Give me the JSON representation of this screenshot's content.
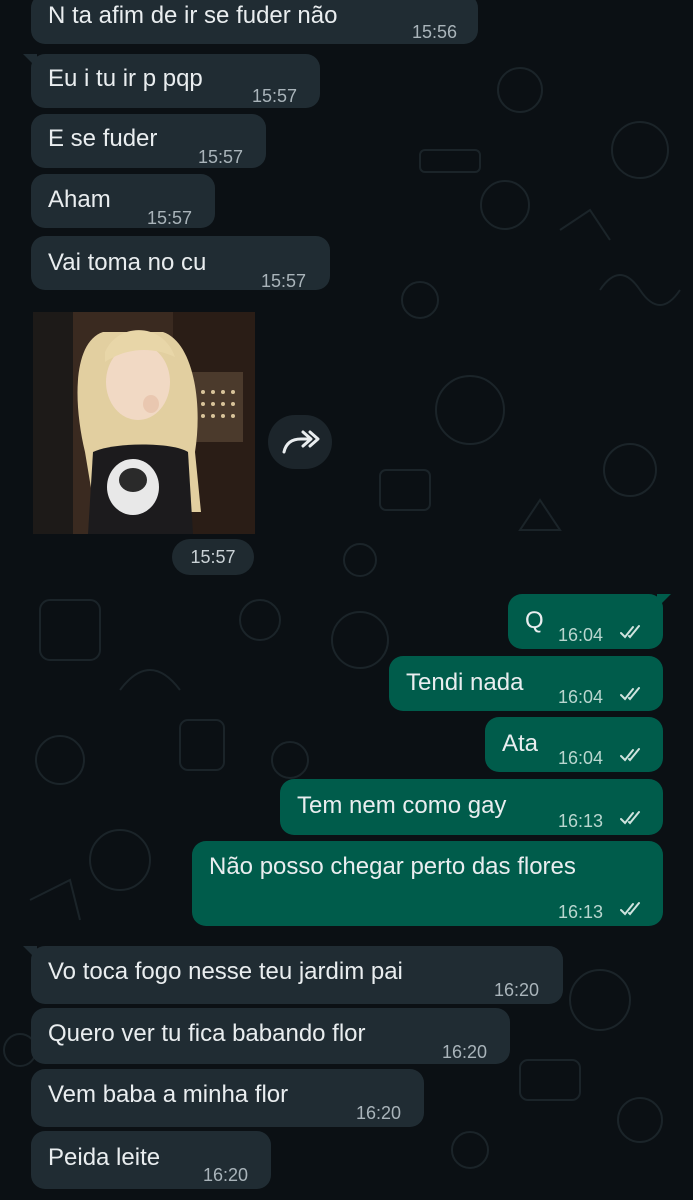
{
  "theme": {
    "background": "#0b1014",
    "incoming_bubble": "#202c33",
    "outgoing_bubble": "#005c4b",
    "read_tick_color": "#cfe3de"
  },
  "messages": [
    {
      "direction": "incoming",
      "text": "N ta afim de ir se fuder não",
      "time": "15:56"
    },
    {
      "direction": "incoming",
      "text": "Eu i tu ir p pqp",
      "time": "15:57"
    },
    {
      "direction": "incoming",
      "text": "E se fuder",
      "time": "15:57"
    },
    {
      "direction": "incoming",
      "text": "Aham",
      "time": "15:57"
    },
    {
      "direction": "incoming",
      "text": "Vai toma no cu",
      "time": "15:57"
    },
    {
      "direction": "incoming",
      "type": "image",
      "time": "15:57",
      "forward_icon": "forward-icon"
    },
    {
      "direction": "outgoing",
      "text": "Q",
      "time": "16:04",
      "status": "read"
    },
    {
      "direction": "outgoing",
      "text": "Tendi nada",
      "time": "16:04",
      "status": "read"
    },
    {
      "direction": "outgoing",
      "text": "Ata",
      "time": "16:04",
      "status": "read"
    },
    {
      "direction": "outgoing",
      "text": "Tem nem como gay",
      "time": "16:13",
      "status": "read"
    },
    {
      "direction": "outgoing",
      "text": "Não posso chegar perto das flores",
      "time": "16:13",
      "status": "read"
    },
    {
      "direction": "incoming",
      "text": "Vo toca fogo nesse teu jardim pai",
      "time": "16:20"
    },
    {
      "direction": "incoming",
      "text": "Quero ver tu fica babando flor",
      "time": "16:20"
    },
    {
      "direction": "incoming",
      "text": "Vem baba a minha flor",
      "time": "16:20"
    },
    {
      "direction": "incoming",
      "text": "Peida leite",
      "time": "16:20"
    }
  ]
}
